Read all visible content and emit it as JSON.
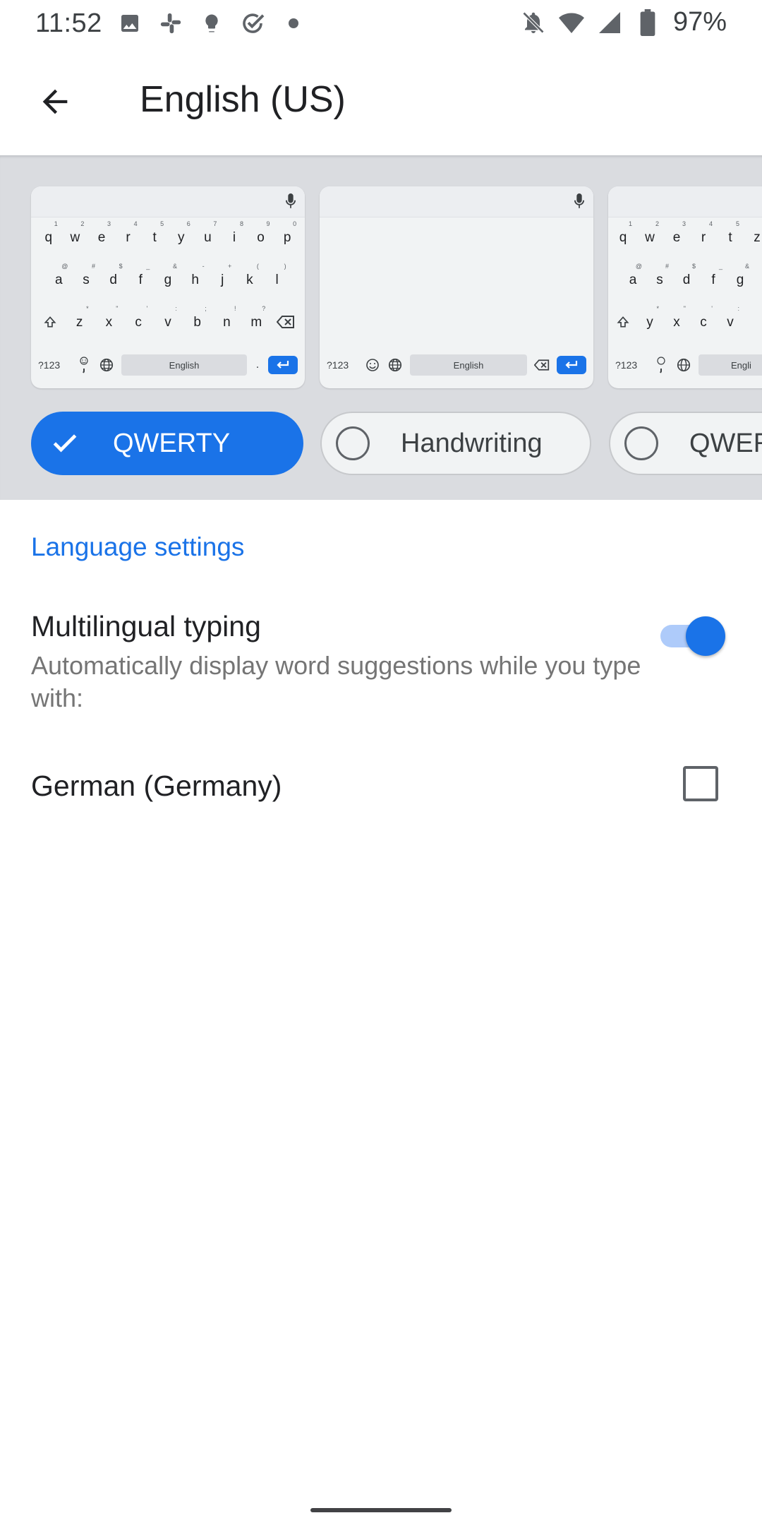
{
  "status_bar": {
    "time": "11:52",
    "battery": "97%",
    "left_icons": [
      "image-icon",
      "slack-icon",
      "bulb-icon",
      "check-circle-icon",
      "dot-icon"
    ],
    "right_icons": [
      "notifications-off-icon",
      "wifi-icon",
      "signal-icon",
      "battery-icon"
    ]
  },
  "app_bar": {
    "back_icon": "arrow-back-icon",
    "title": "English (US)"
  },
  "keyboards": {
    "qwerty_rows": [
      [
        "q",
        "w",
        "e",
        "r",
        "t",
        "y",
        "u",
        "i",
        "o",
        "p"
      ],
      [
        "a",
        "s",
        "d",
        "f",
        "g",
        "h",
        "j",
        "k",
        "l"
      ],
      [
        "z",
        "x",
        "c",
        "v",
        "b",
        "n",
        "m"
      ]
    ],
    "qwerty_supers": [
      [
        "1",
        "2",
        "3",
        "4",
        "5",
        "6",
        "7",
        "8",
        "9",
        "0"
      ],
      [
        "@",
        "#",
        "$",
        "_",
        "&",
        "-",
        "+",
        "(",
        ")"
      ],
      [
        "*",
        "\"",
        "'",
        ":",
        ";",
        "!",
        "?"
      ]
    ],
    "symbols_label": "?123",
    "space_label": "English",
    "period": ".",
    "comma": ",",
    "third_rows": [
      [
        "q",
        "w",
        "e",
        "r",
        "t",
        "z"
      ],
      [
        "a",
        "s",
        "d",
        "f",
        "g"
      ],
      [
        "y",
        "x",
        "c",
        "v"
      ]
    ],
    "third_supers": [
      [
        "1",
        "2",
        "3",
        "4",
        "5",
        ""
      ],
      [
        "@",
        "#",
        "$",
        "_",
        "&"
      ],
      [
        "*",
        "\"",
        "'",
        ":"
      ]
    ],
    "third_space_label": "Engli"
  },
  "layouts": [
    {
      "label": "QWERTY",
      "selected": true
    },
    {
      "label": "Handwriting",
      "selected": false
    },
    {
      "label": "QWER",
      "selected": false
    }
  ],
  "settings": {
    "section_header": "Language settings",
    "multilingual": {
      "title": "Multilingual typing",
      "summary": "Automatically display word suggestions while you type with:",
      "enabled": true
    },
    "german": {
      "title": "German (Germany)",
      "checked": false
    }
  },
  "colors": {
    "accent": "#1a73e8",
    "accent_light": "#aecbfa",
    "band_bg": "#dadce0"
  }
}
